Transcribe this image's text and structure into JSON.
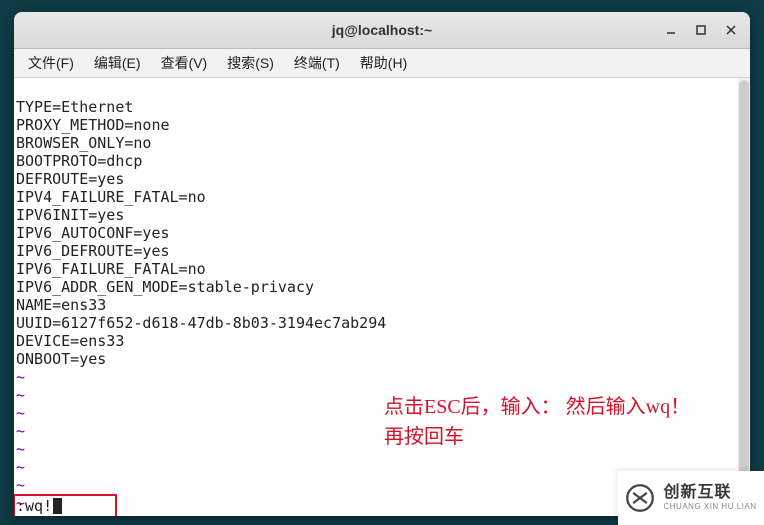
{
  "window": {
    "title": "jq@localhost:~"
  },
  "menu": {
    "file": "文件(F)",
    "edit": "编辑(E)",
    "view": "查看(V)",
    "search": "搜索(S)",
    "terminal": "终端(T)",
    "help": "帮助(H)"
  },
  "file_content": {
    "lines": [
      "TYPE=Ethernet",
      "PROXY_METHOD=none",
      "BROWSER_ONLY=no",
      "BOOTPROTO=dhcp",
      "DEFROUTE=yes",
      "IPV4_FAILURE_FATAL=no",
      "IPV6INIT=yes",
      "IPV6_AUTOCONF=yes",
      "IPV6_DEFROUTE=yes",
      "IPV6_FAILURE_FATAL=no",
      "IPV6_ADDR_GEN_MODE=stable-privacy",
      "NAME=ens33",
      "UUID=6127f652-d618-47db-8b03-3194ec7ab294",
      "DEVICE=ens33",
      "ONBOOT=yes"
    ]
  },
  "tilde": "~",
  "command_line": ":wq!",
  "annotation": {
    "line1": "点击ESC后，输入：  然后输入wq！",
    "line2": "再按回车"
  },
  "watermark": {
    "cn": "创新互联",
    "en": "CHUANG XIN HU LIAN"
  }
}
